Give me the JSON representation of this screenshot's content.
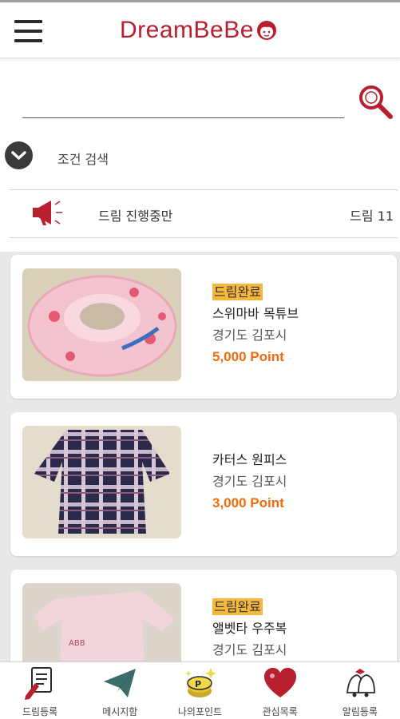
{
  "header": {
    "logo_text": "DreamBeBe",
    "brand_color": "#b8202f"
  },
  "search": {
    "value": "",
    "placeholder": ""
  },
  "condition_search": {
    "label": "조건 검색"
  },
  "dream_filter": {
    "label": "드림 진행중만",
    "count_label": "드림 11"
  },
  "items": [
    {
      "badge": "드림완료",
      "title": "스위마바 목튜브",
      "location": "경기도 김포시",
      "price": "5,000 Point"
    },
    {
      "badge": "",
      "title": "카터스 원피스",
      "location": "경기도 김포시",
      "price": "3,000 Point"
    },
    {
      "badge": "드림완료",
      "title": "앨벳타 우주복",
      "location": "경기도 김포시",
      "price": ""
    }
  ],
  "bottom_nav": [
    {
      "label": "드림등록",
      "icon": "document-pen-icon"
    },
    {
      "label": "메시지함",
      "icon": "paper-plane-icon"
    },
    {
      "label": "나의포인트",
      "icon": "point-coin-icon"
    },
    {
      "label": "관심목록",
      "icon": "heart-icon"
    },
    {
      "label": "알림등록",
      "icon": "bell-icon"
    }
  ],
  "colors": {
    "accent": "#b8202f",
    "price": "#f36b0a",
    "badge": "#f6b83c"
  }
}
